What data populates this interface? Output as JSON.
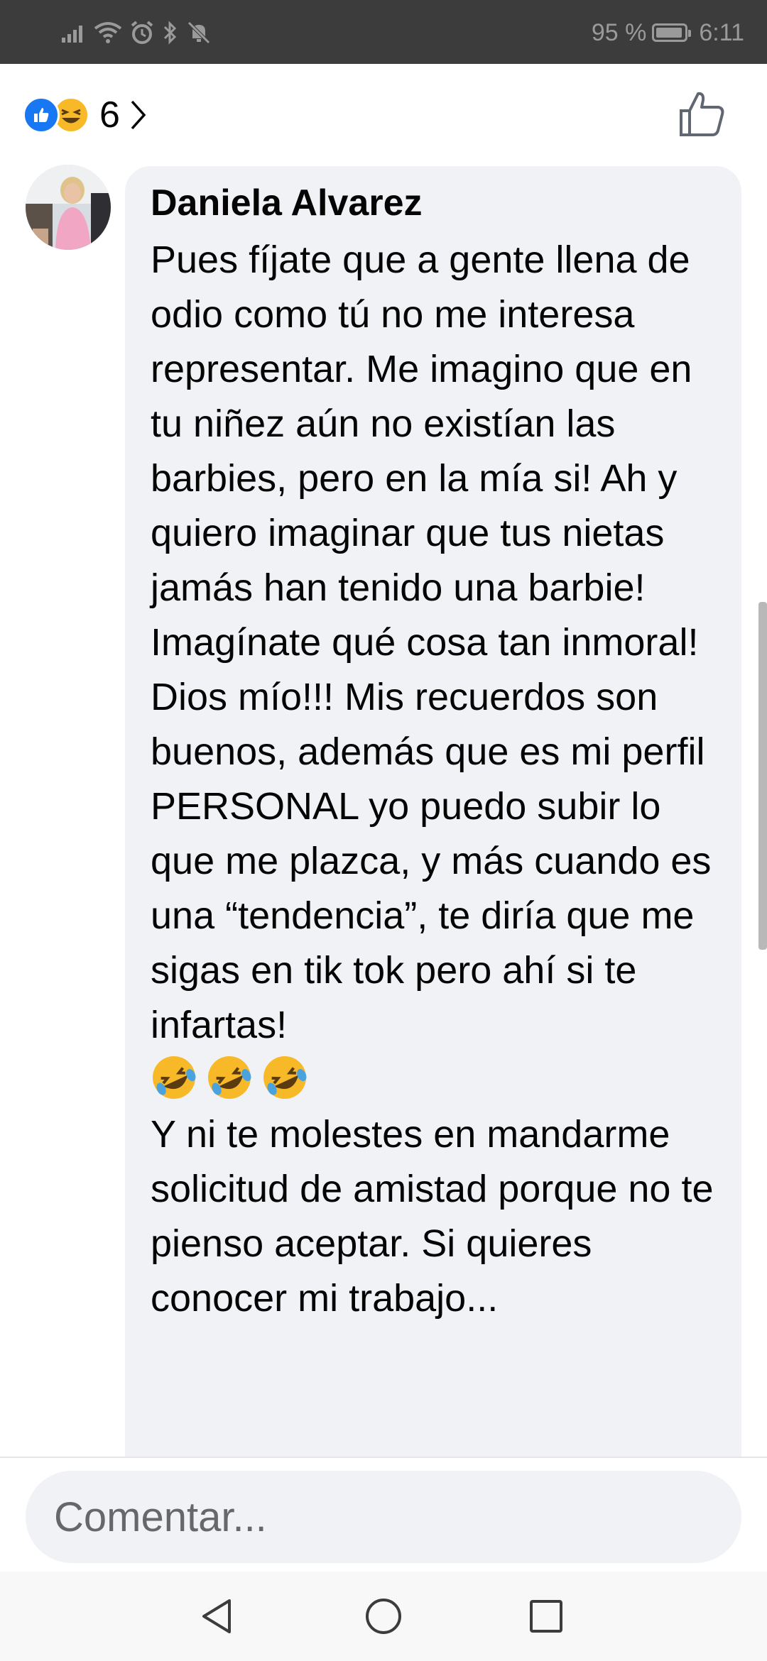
{
  "status_bar": {
    "battery": "95 %",
    "time": "6:11",
    "icons": [
      "signal-icon",
      "wifi-icon",
      "alarm-icon",
      "bluetooth-icon",
      "mute-icon",
      "battery-icon"
    ]
  },
  "reactions": {
    "types": [
      "like",
      "haha"
    ],
    "count": "6",
    "like_color": "#1877f2",
    "haha_color": "#f7b928"
  },
  "comment": {
    "author": "Daniela Alvarez",
    "text_main": "Pues fíjate que a gente llena de odio como tú no me interesa representar. Me imagino que en tu niñez aún no existían las barbies, pero en la mía si! Ah y quiero imaginar que tus nietas jamás han tenido una barbie! Imagínate qué cosa tan inmoral! Dios mío!!! Mis recuerdos son buenos, además que es mi perfil PERSONAL yo puedo subir lo que me plazca, y más cuando es una “tendencia”, te diría que me sigas en tik tok pero ahí si te infartas!",
    "emojis": [
      "rolling-on-floor-laughing",
      "rolling-on-floor-laughing",
      "rolling-on-floor-laughing"
    ],
    "text_continued": "Y ni te molestes en mandarme solicitud de amistad porque no te pienso aceptar. Si quieres conocer mi trabajo..."
  },
  "composer": {
    "placeholder": "Comentar..."
  },
  "colors": {
    "bubble_bg": "#f0f2f5",
    "text": "#050505",
    "status_bar_bg": "#3c3c3c"
  }
}
